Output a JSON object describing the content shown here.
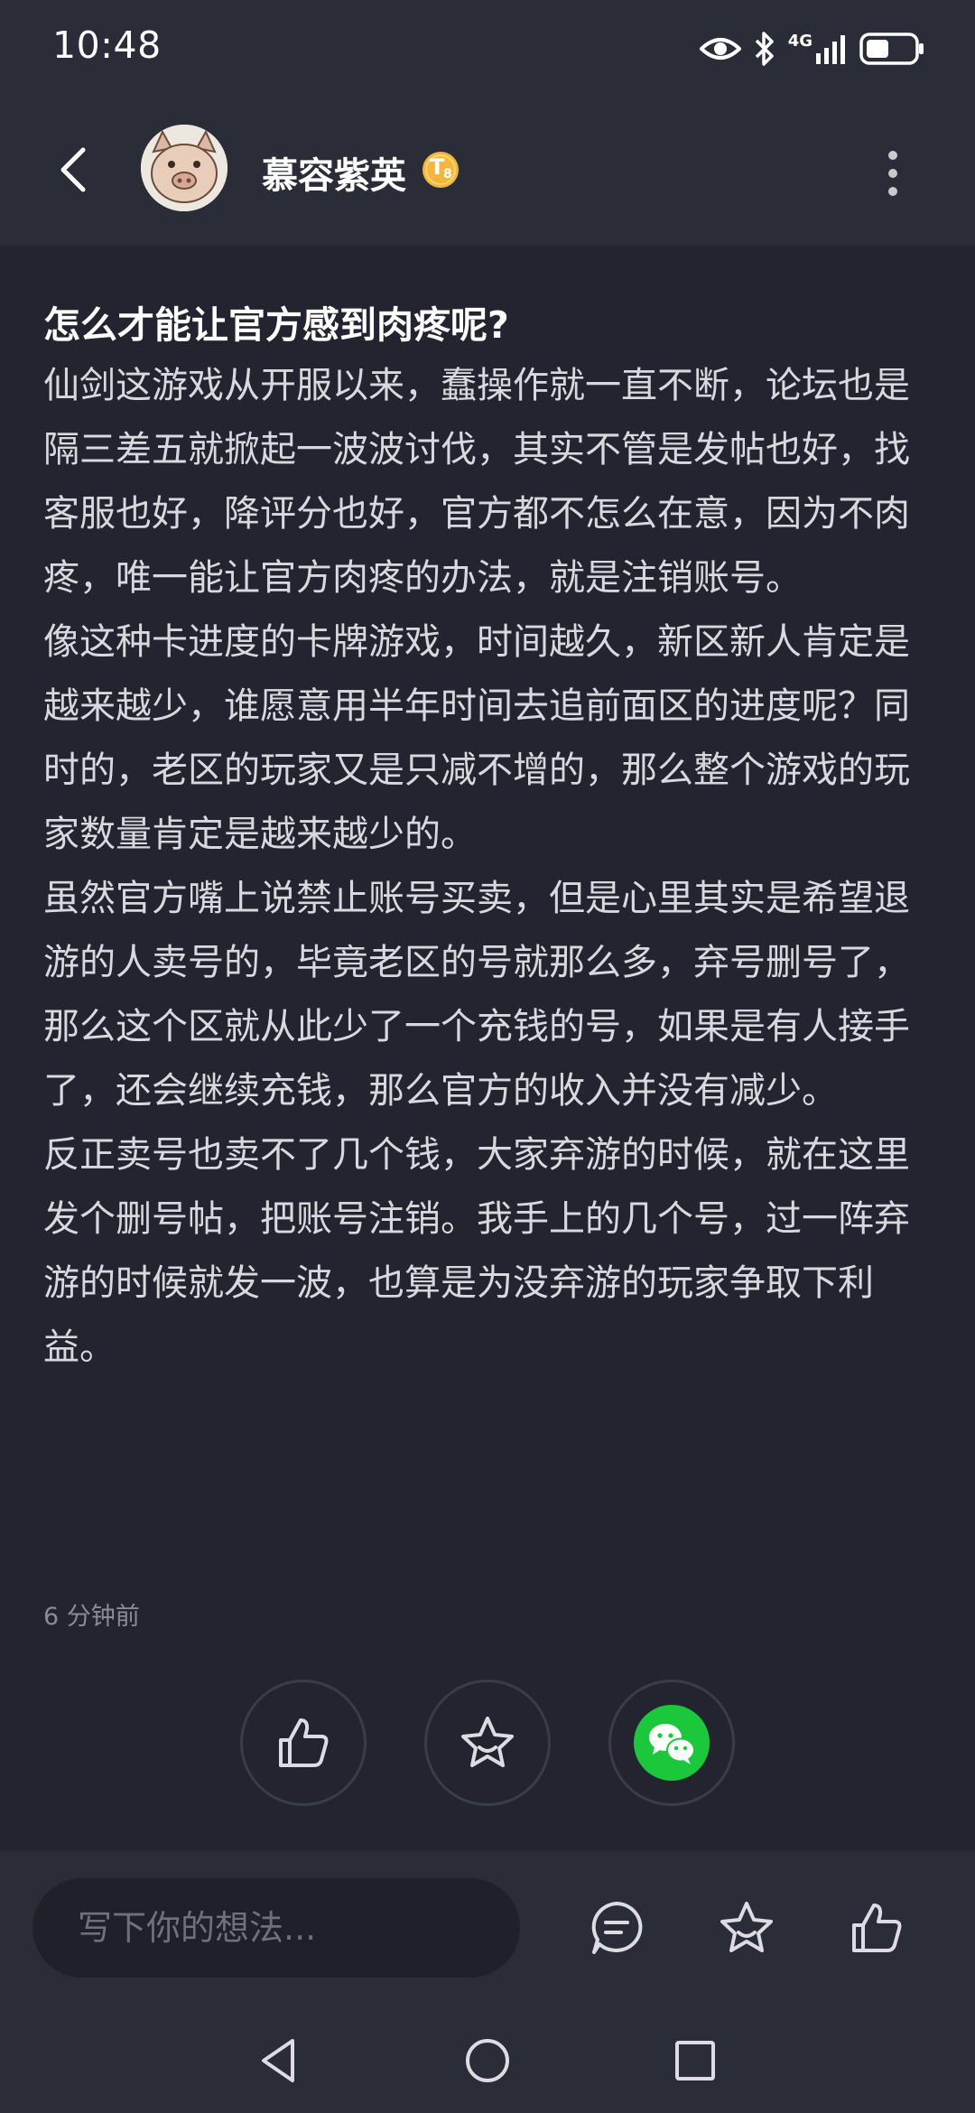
{
  "status_bar": {
    "time": "10:48",
    "network_label": "4G",
    "icons": [
      "eye-icon",
      "bluetooth-icon",
      "signal-icon",
      "battery-icon"
    ]
  },
  "header": {
    "username": "慕容紫英",
    "badge_text": "T",
    "badge_sub": "8",
    "icons": [
      "back-arrow-icon",
      "more-vertical-icon"
    ]
  },
  "post": {
    "title": "怎么才能让官方感到肉疼呢?",
    "paragraphs": [
      "仙剑这游戏从开服以来，蠢操作就一直不断，论坛也是隔三差五就掀起一波波讨伐，其实不管是发帖也好，找客服也好，降评分也好，官方都不怎么在意，因为不肉疼，唯一能让官方肉疼的办法，就是注销账号。",
      "像这种卡进度的卡牌游戏，时间越久，新区新人肯定是越来越少，谁愿意用半年时间去追前面区的进度呢？同时的，老区的玩家又是只减不增的，那么整个游戏的玩家数量肯定是越来越少的。",
      "虽然官方嘴上说禁止账号买卖，但是心里其实是希望退游的人卖号的，毕竟老区的号就那么多，弃号删号了，那么这个区就从此少了一个充钱的号，如果是有人接手了，还会继续充钱，那么官方的收入并没有减少。",
      "反正卖号也卖不了几个钱，大家弃游的时候，就在这里发个删号帖，把账号注销。我手上的几个号，过一阵弃游的时候就发一波，也算是为没弃游的玩家争取下利益。"
    ],
    "time": "6 分钟前"
  },
  "actions": [
    "like-icon",
    "favorite-icon",
    "wechat-share-icon"
  ],
  "bottom_bar": {
    "comment_placeholder": "写下你的想法...",
    "icons": [
      "comment-icon",
      "favorite-icon",
      "like-icon"
    ]
  },
  "navigation": [
    "nav-back-icon",
    "nav-home-icon",
    "nav-recents-icon"
  ],
  "colors": {
    "background": "#232430",
    "bar": "#2a2c37",
    "wechat_green": "#1bc83c",
    "badge_gold": "#f5b73b"
  }
}
